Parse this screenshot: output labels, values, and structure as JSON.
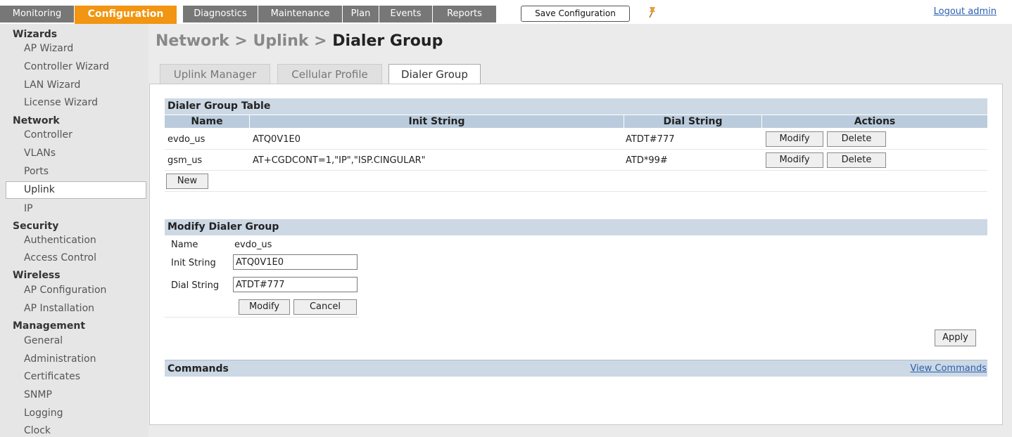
{
  "topnav": {
    "tabs": [
      {
        "label": "Monitoring"
      },
      {
        "label": "Configuration"
      },
      {
        "label": "Diagnostics"
      },
      {
        "label": "Maintenance"
      },
      {
        "label": "Plan"
      },
      {
        "label": "Events"
      },
      {
        "label": "Reports"
      }
    ],
    "save_label": "Save Configuration",
    "logout_label": "Logout admin"
  },
  "sidebar": {
    "wizards": "Wizards",
    "ap_wizard": "AP Wizard",
    "controller_wizard": "Controller Wizard",
    "lan_wizard": "LAN Wizard",
    "license_wizard": "License Wizard",
    "network": "Network",
    "controller": "Controller",
    "vlans": "VLANs",
    "ports": "Ports",
    "uplink": "Uplink",
    "ip": "IP",
    "security": "Security",
    "authentication": "Authentication",
    "access_control": "Access Control",
    "wireless": "Wireless",
    "ap_configuration": "AP Configuration",
    "ap_installation": "AP Installation",
    "management": "Management",
    "general": "General",
    "administration": "Administration",
    "certificates": "Certificates",
    "snmp": "SNMP",
    "logging": "Logging",
    "clock": "Clock"
  },
  "page": {
    "breadcrumb": "Network > Uplink > ",
    "current": "Dialer Group"
  },
  "subtabs": [
    "Uplink Manager",
    "Cellular Profile",
    "Dialer Group"
  ],
  "dialer_table": {
    "title": "Dialer Group Table",
    "columns": [
      "Name",
      "Init String",
      "Dial String",
      "Actions"
    ],
    "rows": [
      {
        "name": "evdo_us",
        "init": "ATQ0V1E0",
        "dial": "ATDT#777"
      },
      {
        "name": "gsm_us",
        "init": "AT+CGDCONT=1,\"IP\",\"ISP.CINGULAR\"",
        "dial": "ATD*99#"
      }
    ],
    "modify_label": "Modify",
    "delete_label": "Delete",
    "new_label": "New"
  },
  "modify_form": {
    "title": "Modify Dialer Group",
    "name_label": "Name",
    "name_value": "evdo_us",
    "init_label": "Init String",
    "init_value": "ATQ0V1E0",
    "dial_label": "Dial String",
    "dial_value": "ATDT#777",
    "modify_label": "Modify",
    "cancel_label": "Cancel"
  },
  "apply_label": "Apply",
  "commands": {
    "title": "Commands",
    "link": "View Commands"
  },
  "colors": {
    "accent": "#f29512",
    "tab_gray": "#777777",
    "section_header": "#ccd8e4",
    "column_header": "#b9cbdc",
    "link": "#2b5fad"
  }
}
